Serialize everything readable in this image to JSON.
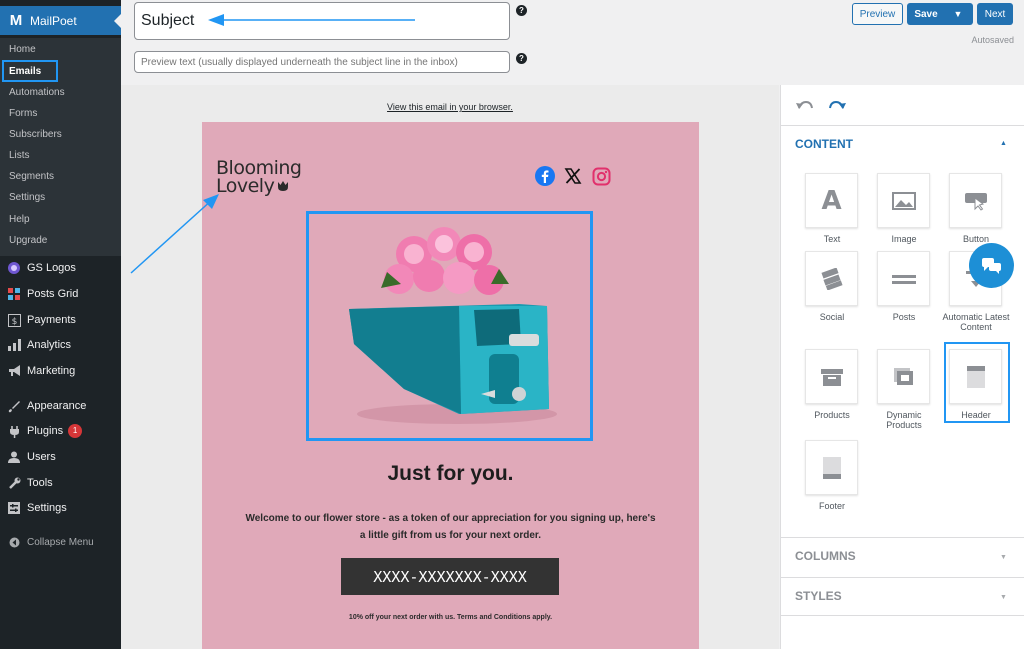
{
  "sidebar": {
    "brand": {
      "label": "MailPoet",
      "icon": "mailpoet-m-icon"
    },
    "submenu": [
      {
        "label": "Home"
      },
      {
        "label": "Emails",
        "active": true
      },
      {
        "label": "Automations"
      },
      {
        "label": "Forms"
      },
      {
        "label": "Subscribers"
      },
      {
        "label": "Lists"
      },
      {
        "label": "Segments"
      },
      {
        "label": "Settings"
      },
      {
        "label": "Help"
      },
      {
        "label": "Upgrade"
      }
    ],
    "menu": [
      {
        "label": "GS Logos",
        "icon": "gs-logos-icon"
      },
      {
        "label": "Posts Grid",
        "icon": "grid-icon"
      },
      {
        "label": "Payments",
        "icon": "dollar-icon"
      },
      {
        "label": "Analytics",
        "icon": "bar-chart-icon"
      },
      {
        "label": "Marketing",
        "icon": "megaphone-icon"
      },
      {
        "label": "Appearance",
        "icon": "paintbrush-icon"
      },
      {
        "label": "Plugins",
        "icon": "plug-icon",
        "badge": "1"
      },
      {
        "label": "Users",
        "icon": "user-icon"
      },
      {
        "label": "Tools",
        "icon": "wrench-icon"
      },
      {
        "label": "Settings",
        "icon": "sliders-icon"
      }
    ],
    "collapse_label": "Collapse Menu"
  },
  "top": {
    "subject_value": "Subject",
    "preview_placeholder": "Preview text (usually displayed underneath the subject line in the inbox)",
    "preview_button": "Preview",
    "save_button": "Save",
    "next_button": "Next",
    "autosaved": "Autosaved"
  },
  "email": {
    "view_in_browser": "View this email in your browser.",
    "logo_line1": "Blooming",
    "logo_line2": "Lovely",
    "social_icons": [
      "facebook-icon",
      "x-icon",
      "instagram-icon"
    ],
    "headline": "Just for you.",
    "body": "Welcome to our flower store - as a token of our appreciation for you signing up, here's a little gift from us for your next order.",
    "coupon": "XXXX-XXXXXXX-XXXX",
    "footnote": "10% off your next order with us. Terms and Conditions apply.",
    "background_color": "#e0a9b9"
  },
  "panel": {
    "content_header": "CONTENT",
    "blocks": [
      {
        "label": "Text",
        "icon": "text-icon"
      },
      {
        "label": "Image",
        "icon": "image-icon"
      },
      {
        "label": "Button",
        "icon": "button-icon"
      },
      {
        "label": "Social",
        "icon": "social-icon"
      },
      {
        "label": "Posts",
        "icon": "posts-icon"
      },
      {
        "label": "Automatic Latest Content",
        "icon": "alc-icon"
      },
      {
        "label": "Products",
        "icon": "products-icon"
      },
      {
        "label": "Dynamic Products",
        "icon": "dynamic-products-icon"
      },
      {
        "label": "Header",
        "icon": "header-icon"
      },
      {
        "label": "Footer",
        "icon": "footer-icon"
      }
    ],
    "columns_header": "COLUMNS",
    "styles_header": "STYLES"
  },
  "colors": {
    "accent": "#2271b1",
    "highlight": "#2196f3",
    "admin_bg": "#1d2327"
  }
}
